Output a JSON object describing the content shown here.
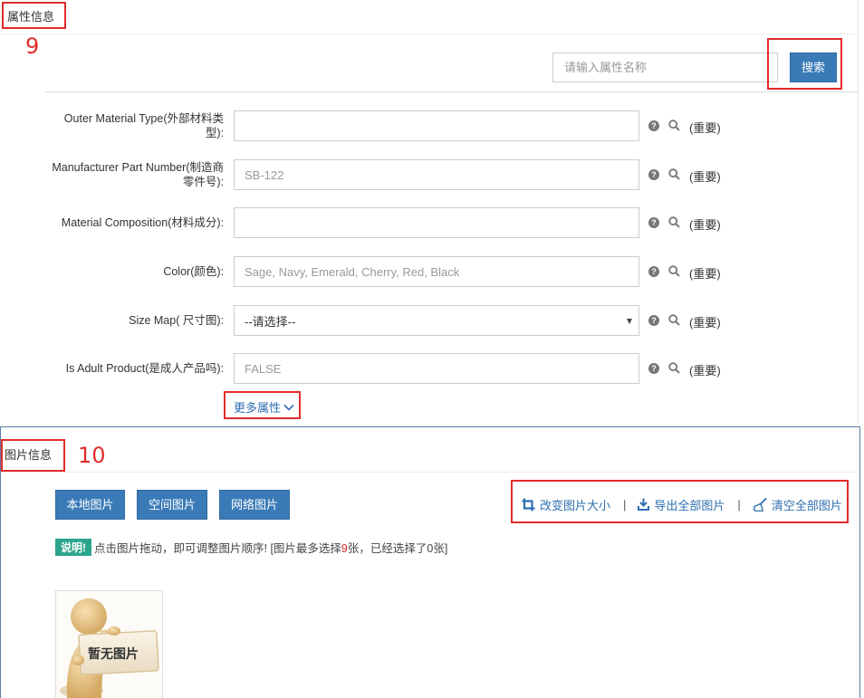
{
  "attributes": {
    "section_title": "属性信息",
    "annotation_number": "9",
    "search": {
      "placeholder": "请输入属性名称",
      "button_label": "搜索"
    },
    "fields": [
      {
        "label_line1": "Outer Material Type(外部材料类",
        "label_line2": "型):",
        "type": "text",
        "value": "",
        "placeholder": "",
        "importance": "(重要)"
      },
      {
        "label_line1": "Manufacturer Part Number(制造商",
        "label_line2": "零件号):",
        "type": "text",
        "value": "",
        "placeholder": "SB-122",
        "importance": "(重要)"
      },
      {
        "label_line1": "Material Composition(材料成分):",
        "label_line2": "",
        "type": "text",
        "value": "",
        "placeholder": "",
        "importance": "(重要)"
      },
      {
        "label_line1": "Color(颜色):",
        "label_line2": "",
        "type": "text",
        "value": "",
        "placeholder": "Sage, Navy, Emerald, Cherry, Red, Black",
        "importance": "(重要)"
      },
      {
        "label_line1": "Size Map( 尺寸图):",
        "label_line2": "",
        "type": "select",
        "value": "--请选择--",
        "placeholder": "",
        "importance": "(重要)"
      },
      {
        "label_line1": "Is Adult Product(是成人产品吗):",
        "label_line2": "",
        "type": "text",
        "value": "",
        "placeholder": "FALSE",
        "importance": "(重要)"
      }
    ],
    "more_label": "更多属性"
  },
  "images": {
    "section_title": "图片信息",
    "annotation_number": "10",
    "buttons": {
      "local": "本地图片",
      "space": "空间图片",
      "network": "网络图片"
    },
    "toolbar": {
      "resize": "改变图片大小",
      "export": "导出全部图片",
      "clear": "清空全部图片",
      "separator": "|"
    },
    "note": {
      "badge": "说明!",
      "text_before": "点击图片拖动，即可调整图片顺序! [图片最多选择",
      "max_count": "9",
      "text_middle": "张，已经选择了",
      "selected_count": "0",
      "text_after": "张]"
    },
    "placeholder_caption": "暂无图片"
  },
  "colors": {
    "primary_button": "#3a7ab7",
    "link": "#2f6fb0",
    "annotation_red": "#e12b2b",
    "note_badge": "#2ca58d"
  }
}
